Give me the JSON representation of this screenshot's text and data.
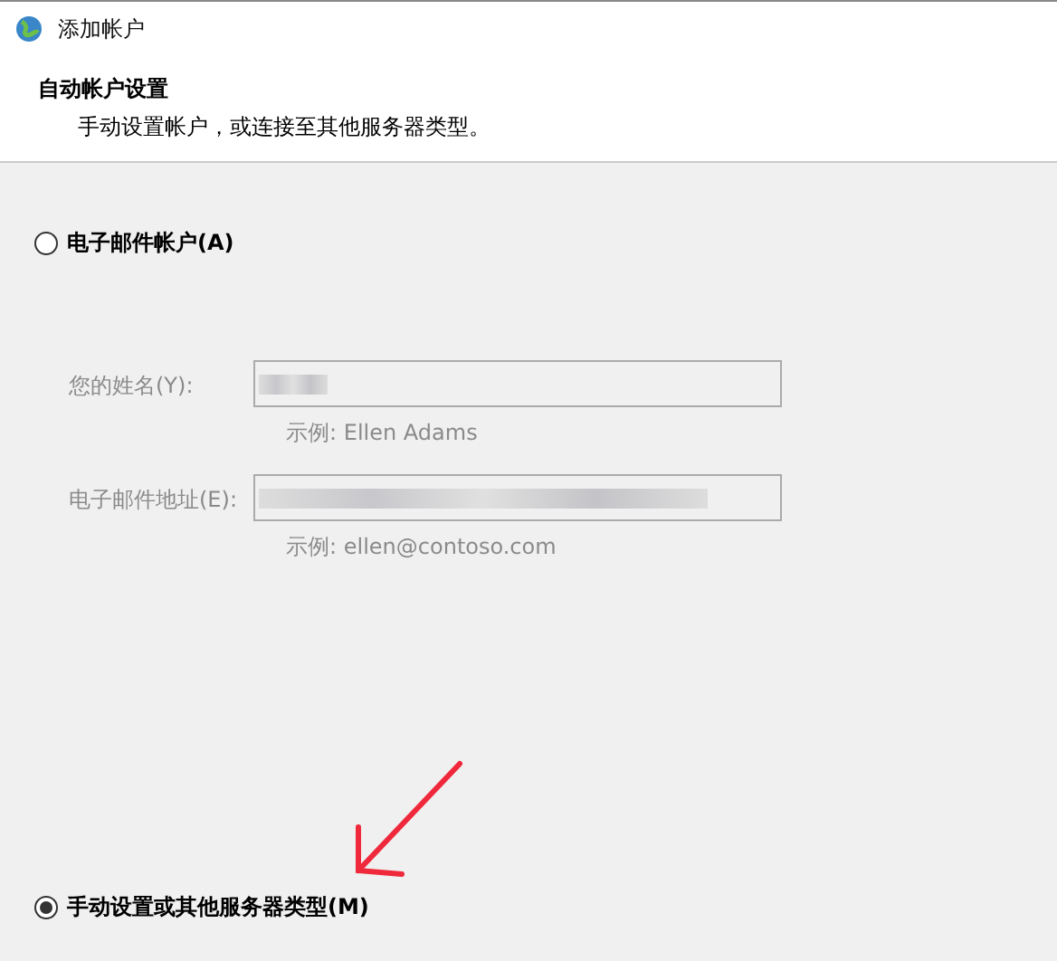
{
  "window": {
    "title": "添加帐户"
  },
  "header": {
    "title": "自动帐户设置",
    "subtitle": "手动设置帐户，或连接至其他服务器类型。"
  },
  "options": [
    {
      "kind": "email",
      "label": "电子邮件帐户(A)",
      "selected": false,
      "fields": [
        {
          "label": "您的姓名(Y):",
          "redacted": true,
          "hint": "示例: Ellen Adams"
        },
        {
          "label": "电子邮件地址(E):",
          "redacted": true,
          "hint": "示例: ellen@contoso.com"
        }
      ]
    },
    {
      "kind": "manual",
      "label": "手动设置或其他服务器类型(M)",
      "selected": true
    }
  ],
  "annotation": {
    "kind": "arrow",
    "color": "#f0283c"
  }
}
